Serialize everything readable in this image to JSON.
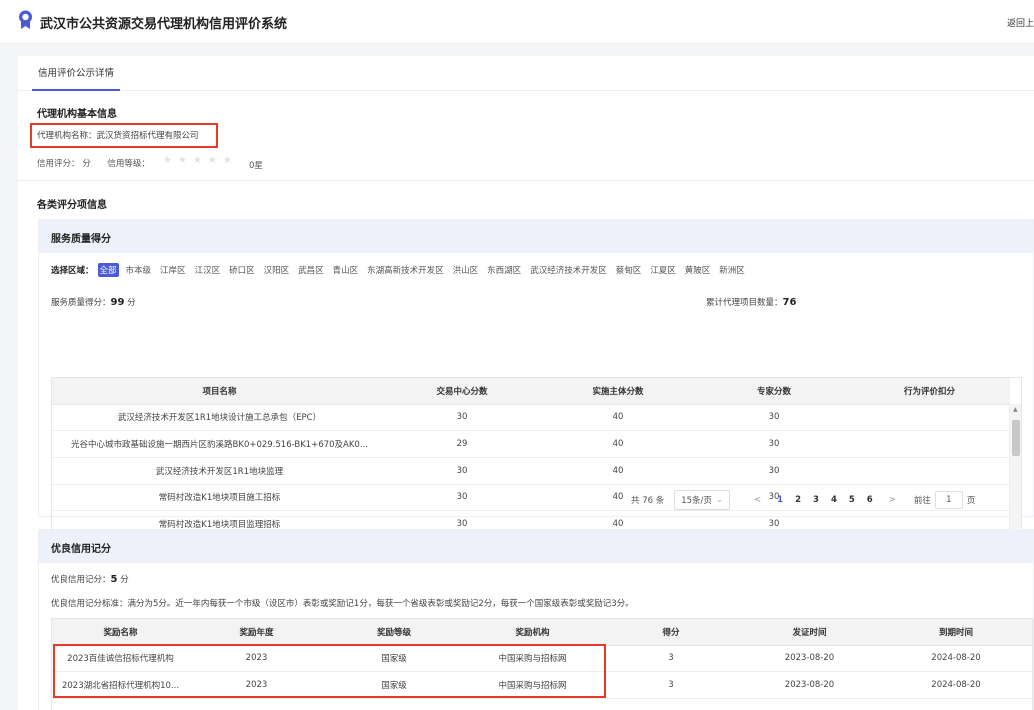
{
  "header": {
    "title": "武汉市公共资源交易代理机构信用评价系统",
    "back_label": "返回上"
  },
  "tab": {
    "label": "信用评价公示详情"
  },
  "basic": {
    "section_title": "代理机构基本信息",
    "name_text": "代理机构名称：武汉货资招标代理有限公司",
    "score_text": "信用评分：   分",
    "level_text": "信用等级：",
    "star_rating": 0,
    "star_label": "0星"
  },
  "categories_title": "各类评分项信息",
  "service": {
    "panel_title": "服务质量得分",
    "region_label": "选择区域：",
    "regions": [
      "全部",
      "市本级",
      "江岸区",
      "江汉区",
      "硚口区",
      "汉阳区",
      "武昌区",
      "青山区",
      "东湖高新技术开发区",
      "洪山区",
      "东西湖区",
      "武汉经济技术开发区",
      "蔡甸区",
      "江夏区",
      "黄陂区",
      "新洲区"
    ],
    "score_label": "服务质量得分：",
    "score_value": "99",
    "score_unit": "分",
    "count_label": "累计代理项目数量：",
    "count_value": "76",
    "columns": [
      "项目名称",
      "交易中心分数",
      "实施主体分数",
      "专家分数",
      "行为评价扣分"
    ],
    "rows": [
      [
        "武汉经济技术开发区1R1地块设计施工总承包（EPC）",
        "30",
        "40",
        "30",
        ""
      ],
      [
        "光谷中心城市政基础设施一期西片区豹溪路BK0+029.516-BK1+670及AK0...",
        "29",
        "40",
        "30",
        ""
      ],
      [
        "武汉经济技术开发区1R1地块监理",
        "30",
        "40",
        "30",
        ""
      ],
      [
        "常码村改造K1地块项目施工招标",
        "30",
        "40",
        "30",
        ""
      ],
      [
        "常码村改造K1地块项目监理招标",
        "30",
        "40",
        "30",
        ""
      ]
    ],
    "pager": {
      "total": "共 76 条",
      "page_size": "15条/页",
      "prev": "<",
      "next": ">",
      "pages": [
        "1",
        "2",
        "3",
        "4",
        "5",
        "6"
      ],
      "current": "1",
      "goto_label": "前往",
      "goto_value": "1",
      "goto_unit": "页"
    }
  },
  "good": {
    "panel_title": "优良信用记分",
    "score_label": "优良信用记分：",
    "score_value": "5",
    "score_unit": "分",
    "standard_text": "优良信用记分标准：满分为5分。近一年内每获一个市级（设区市）表彰或奖励记1分，每获一个省级表彰或奖励记2分，每获一个国家级表彰或奖励记3分。",
    "columns": [
      "奖励名称",
      "奖励年度",
      "奖励等级",
      "奖励机构",
      "得分",
      "发证时间",
      "到期时间"
    ],
    "rows": [
      [
        "2023百佳诚信招标代理机构",
        "2023",
        "国家级",
        "中国采购与招标网",
        "3",
        "2023-08-20",
        "2024-08-20"
      ],
      [
        "2023湖北省招标代理机构10...",
        "2023",
        "国家级",
        "中国采购与招标网",
        "3",
        "2023-08-20",
        "2024-08-20"
      ]
    ]
  },
  "colors": {
    "accent": "#4b5bd6",
    "highlight": "#e23b2a"
  },
  "icons": {
    "logo": "medal-icon",
    "star": "star-icon",
    "dropdown": "chevron-down-icon"
  }
}
